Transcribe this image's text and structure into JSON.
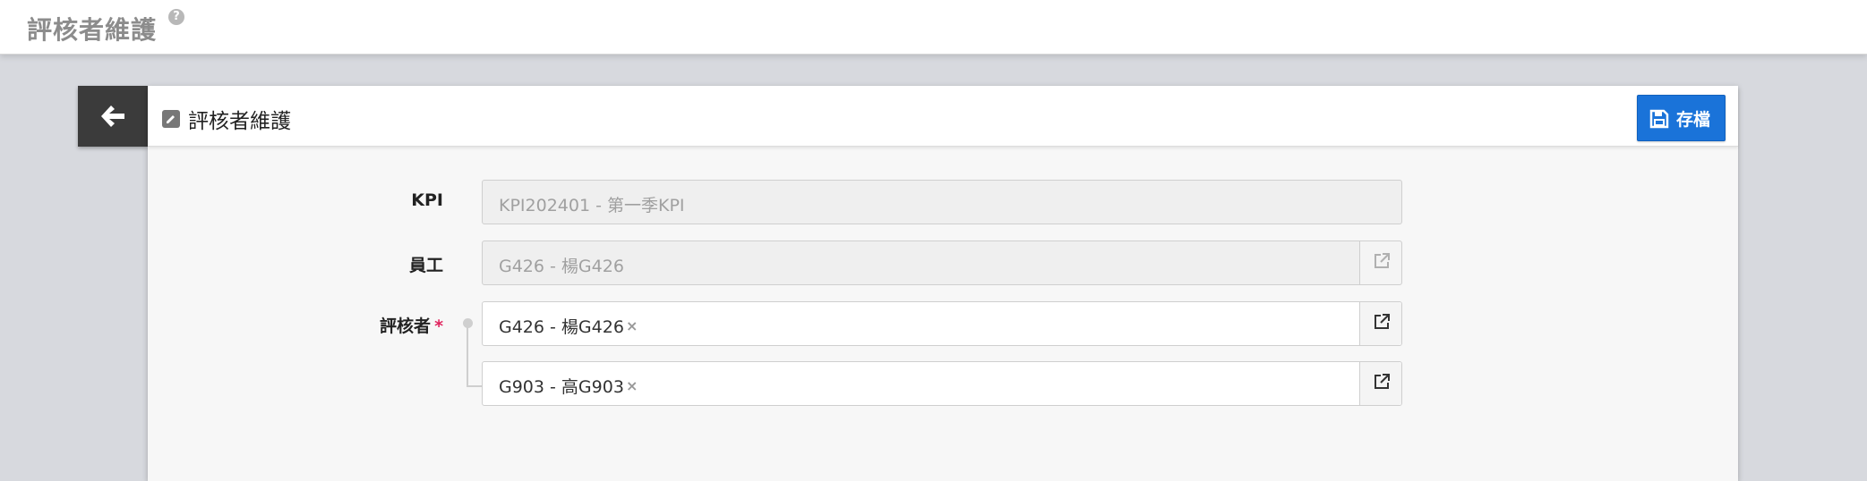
{
  "header": {
    "title": "評核者維護",
    "help_icon": "question-circle-icon"
  },
  "panel": {
    "title": "評核者維護",
    "back_icon": "arrow-left-icon",
    "edit_icon": "pencil-square-icon",
    "save_label": "存檔",
    "save_icon": "floppy-disk-icon",
    "save_color": "#1a73d9"
  },
  "form": {
    "kpi": {
      "label": "KPI",
      "value": "KPI202401 - 第一季KPI"
    },
    "employee": {
      "label": "員工",
      "value": "G426 - 楊G426",
      "link_icon": "external-link-icon"
    },
    "reviewers": {
      "label": "評核者",
      "required_mark": "*",
      "items": [
        {
          "value": "G426 - 楊G426",
          "remove": "×"
        },
        {
          "value": "G903 - 高G903",
          "remove": "×"
        }
      ]
    }
  }
}
